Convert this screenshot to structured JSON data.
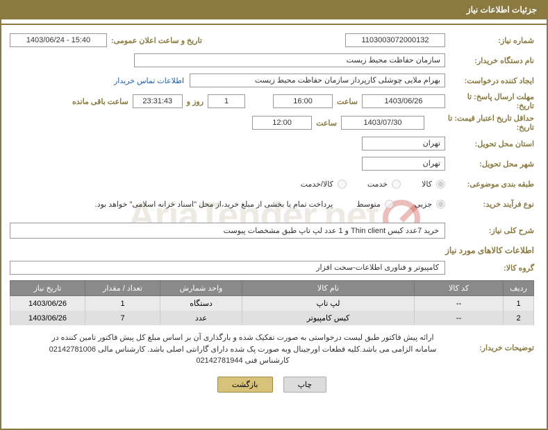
{
  "header_title": "جزئیات اطلاعات نیاز",
  "labels": {
    "need_no": "شماره نیاز:",
    "announce_datetime": "تاریخ و ساعت اعلان عمومی:",
    "buyer_org": "نام دستگاه خریدار:",
    "requester": "ایجاد کننده درخواست:",
    "contact_link": "اطلاعات تماس خریدار",
    "reply_deadline": "مهلت ارسال پاسخ: تا تاریخ:",
    "hour": "ساعت",
    "days_and": "روز و",
    "remaining": "ساعت باقی مانده",
    "min_validity": "حداقل تاریخ اعتبار قیمت: تا تاریخ:",
    "delivery_province": "استان محل تحویل:",
    "delivery_city": "شهر محل تحویل:",
    "category_type": "طبقه بندی موضوعی:",
    "purchase_type": "نوع فرآیند خرید:",
    "purchase_note": "پرداخت تمام یا بخشی از مبلغ خرید،از محل \"اسناد خزانه اسلامی\" خواهد بود.",
    "overall_desc": "شرح کلی نیاز:",
    "goods_info": "اطلاعات کالاهای مورد نیاز",
    "goods_group": "گروه کالا:",
    "buyer_notes": "توضیحات خریدار:"
  },
  "values": {
    "need_no": "1103003072000132",
    "announce_datetime": "1403/06/24 - 15:40",
    "buyer_org": "سازمان حفاظت محیط زیست",
    "requester": "بهرام ملایی چوشلی کارپرداز سازمان حفاظت محیط زیست",
    "reply_date": "1403/06/26",
    "reply_time": "16:00",
    "remaining_days": "1",
    "remaining_time": "23:31:43",
    "validity_date": "1403/07/30",
    "validity_time": "12:00",
    "province": "تهران",
    "city": "تهران",
    "overall_desc": "خرید 7عدد کیس Thin client و 1 عدد لپ تاپ طبق مشخصات پیوست",
    "goods_group": "کامپیوتر و فناوری اطلاعات-سخت افزار",
    "buyer_notes": "ارائه پیش فاکتور طبق لیست درخواستی به صورت تفکیک شده و بارگذاری آن بر اساس مبلغ کل پیش فاکتور تامین کننده در سامانه  الزامی می باشد.کلیه قطعات اورجینال وبه صورت پک شده دارای گارانتی اصلی باشد. کارشناس مالی 02142781006 کارشناس فنی 02142781944"
  },
  "radios": {
    "category": [
      {
        "label": "کالا",
        "checked": true
      },
      {
        "label": "خدمت",
        "checked": false
      },
      {
        "label": "کالا/خدمت",
        "checked": false
      }
    ],
    "process": [
      {
        "label": "جزیی",
        "checked": true
      },
      {
        "label": "متوسط",
        "checked": false
      }
    ]
  },
  "table": {
    "headers": [
      "ردیف",
      "کد کالا",
      "نام کالا",
      "واحد شمارش",
      "تعداد / مقدار",
      "تاریخ نیاز"
    ],
    "rows": [
      {
        "idx": "1",
        "code": "--",
        "name": "لپ تاپ",
        "unit": "دستگاه",
        "qty": "1",
        "date": "1403/06/26"
      },
      {
        "idx": "2",
        "code": "--",
        "name": "کیس کامپیوتر",
        "unit": "عدد",
        "qty": "7",
        "date": "1403/06/26"
      }
    ]
  },
  "buttons": {
    "print": "چاپ",
    "back": "بازگشت"
  },
  "watermark": "AriaTender.net"
}
